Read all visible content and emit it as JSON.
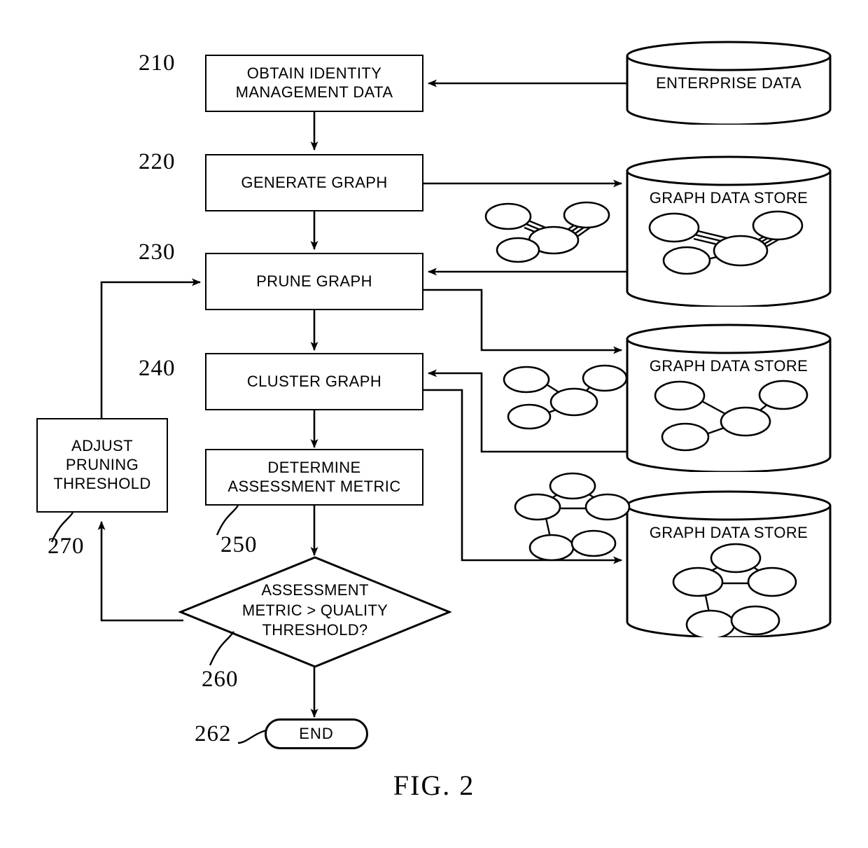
{
  "figure": {
    "caption": "FIG. 2"
  },
  "process_steps": [
    {
      "ref": "210",
      "line1": "OBTAIN IDENTITY",
      "line2": "MANAGEMENT DATA"
    },
    {
      "ref": "220",
      "line1": "GENERATE GRAPH",
      "line2": ""
    },
    {
      "ref": "230",
      "line1": "PRUNE GRAPH",
      "line2": ""
    },
    {
      "ref": "240",
      "line1": "CLUSTER GRAPH",
      "line2": ""
    },
    {
      "ref": "250",
      "line1": "DETERMINE",
      "line2": "ASSESSMENT METRIC"
    }
  ],
  "adjust_box": {
    "ref": "270",
    "line1": "ADJUST",
    "line2": "PRUNING",
    "line3": "THRESHOLD"
  },
  "decision": {
    "ref": "260",
    "line1": "ASSESSMENT",
    "line2": "METRIC > QUALITY",
    "line3": "THRESHOLD?"
  },
  "terminator": {
    "ref": "262",
    "label": "END"
  },
  "data_stores": [
    {
      "id": "enterprise-data",
      "label": "ENTERPRISE DATA",
      "has_graph_icon": false
    },
    {
      "id": "graph-data-store-1",
      "label": "GRAPH DATA STORE",
      "has_graph_icon": true
    },
    {
      "id": "graph-data-store-2",
      "label": "GRAPH DATA STORE",
      "has_graph_icon": true
    },
    {
      "id": "graph-data-store-3",
      "label": "GRAPH DATA STORE",
      "has_graph_icon": true
    }
  ],
  "graph_icons": [
    {
      "id": "graph-icon-dense",
      "description": "dense multi-edge graph"
    },
    {
      "id": "graph-icon-pruned",
      "description": "pruned star graph"
    },
    {
      "id": "graph-icon-clustered",
      "description": "clustered graph"
    }
  ],
  "colors": {
    "stroke": "#000000",
    "background": "#ffffff"
  }
}
